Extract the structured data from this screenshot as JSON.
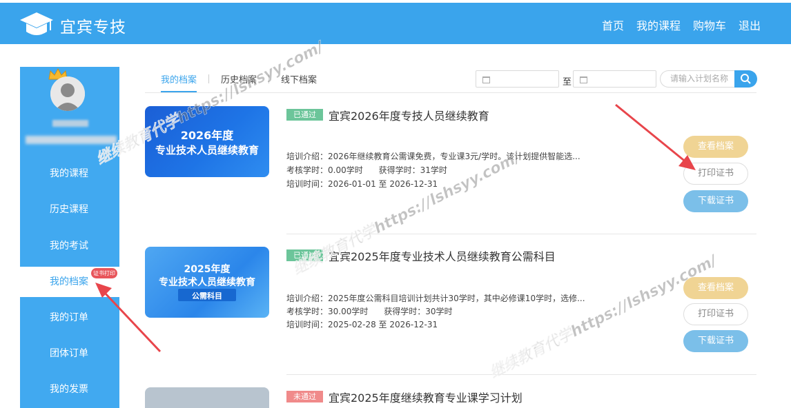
{
  "header": {
    "brand": "宜宾专技",
    "nav": [
      "首页",
      "我的课程",
      "购物车",
      "退出"
    ]
  },
  "sidebar": {
    "items": [
      "我的课程",
      "历史课程",
      "我的考试",
      "我的档案",
      "我的订单",
      "团体订单",
      "我的发票"
    ],
    "active_index": 3,
    "cert_tag": "证书打印"
  },
  "tabs": {
    "items": [
      "我的档案",
      "历史档案",
      "线下档案"
    ],
    "active_index": 0
  },
  "filter": {
    "to_label": "至",
    "search_placeholder": "请输入计划名称"
  },
  "records": [
    {
      "status": "已通过",
      "status_color": "#6cc59a",
      "title": "宜宾2026年度专技人员继续教育",
      "thumb_line1": "2026年度",
      "thumb_line2": "专业技术人员继续教育",
      "thumb_line3": "",
      "intro": "培训介绍：2026年继续教育公需课免费，专业课3元/学时。该计划提供智能选...",
      "hours": "考核学时：0.00学时      获得学时：31学时",
      "time": "培训时间：2026-01-01 至 2026-12-31",
      "buttons": [
        "查看档案",
        "打印证书",
        "下载证书"
      ]
    },
    {
      "status": "已通过",
      "status_color": "#6cc59a",
      "title": "宜宾2025年度专业技术人员继续教育公需科目",
      "thumb_line1": "2025年度",
      "thumb_line2": "专业技术人员继续教育",
      "thumb_line3": "公需科目",
      "intro": "培训介绍：2025年度公需科目培训计划共计30学时，其中必修课10学时，选修...",
      "hours": "考核学时：30.00学时      获得学时：30学时",
      "time": "培训时间：2025-02-28 至 2026-12-31",
      "buttons": [
        "查看档案",
        "打印证书",
        "下载证书"
      ]
    },
    {
      "status": "未通过",
      "status_color": "#f08a8a",
      "title": "宜宾2025年度继续教育专业课学习计划"
    }
  ],
  "watermark": "继续教育代学https://lshsyy.com/",
  "colors": {
    "primary": "#3aa4ec",
    "sidebar": "#41a9f0",
    "view_button": "#f0d494",
    "download_button": "#7bbfe9",
    "arrow": "#e8454b"
  }
}
